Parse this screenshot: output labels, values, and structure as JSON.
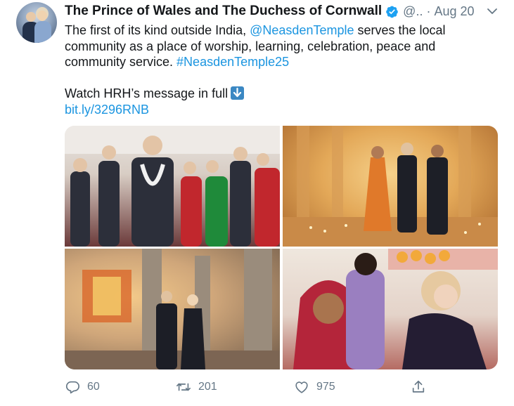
{
  "tweet": {
    "author_name": "The Prince of Wales and The Duchess of Cornwall",
    "handle": "@..",
    "separator": "·",
    "date": "Aug 20",
    "text_line1_pre": "The first of its kind outside India, ",
    "text_line1_link": "@NeasdenTemple",
    "text_line1_post": " serves the local",
    "text_line2": "community as a place of worship, learning, celebration, peace and",
    "text_line3_pre": "community service. ",
    "text_line3_tag": "#NeasdenTemple25",
    "watch_text": "Watch HRH’s message in full",
    "url": "bit.ly/3296RNB"
  },
  "actions": {
    "replies": "60",
    "retweets": "201",
    "likes": "975"
  },
  "colors": {
    "link": "#1b95e0",
    "secondary": "#657786",
    "verified": "#1da1f2"
  },
  "icons": {
    "verified": "verified-badge-icon",
    "caret": "chevron-down-icon",
    "reply": "reply-icon",
    "retweet": "retweet-icon",
    "like": "heart-icon",
    "share": "share-icon",
    "emoji": "down-arrow-emoji"
  }
}
